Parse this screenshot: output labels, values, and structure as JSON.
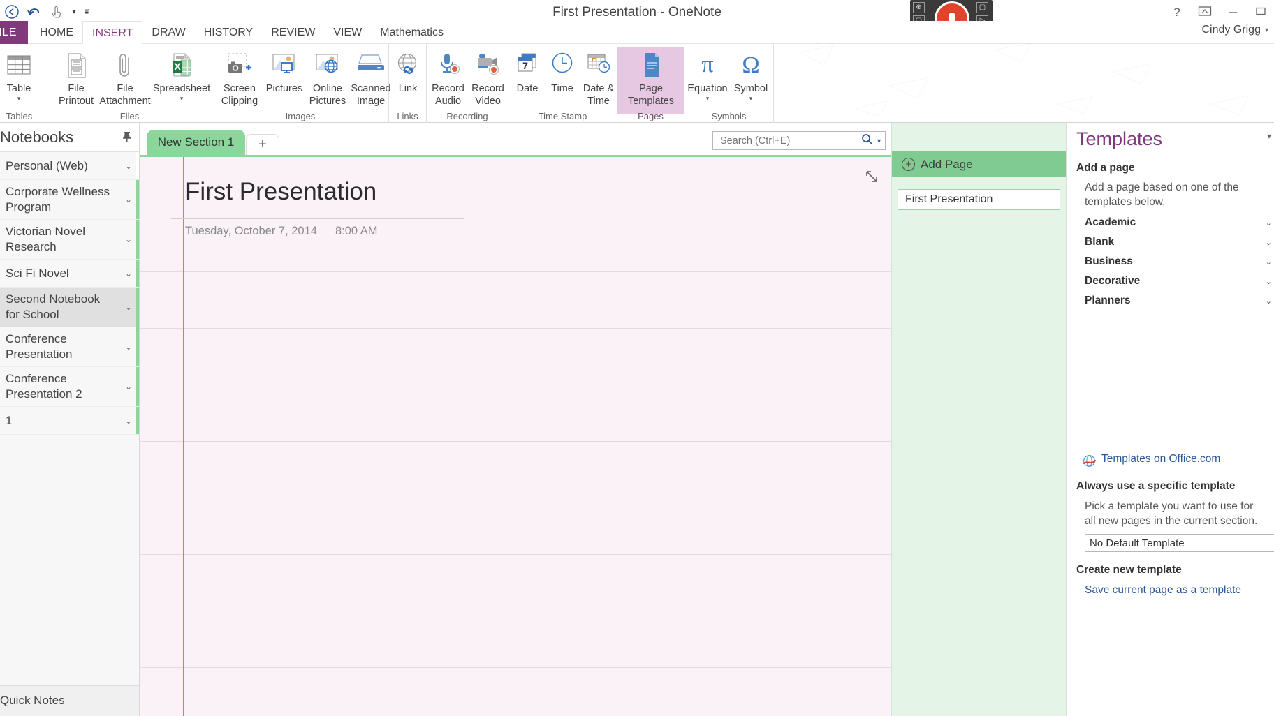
{
  "window": {
    "title": "First Presentation - OneNote",
    "account": "Cindy Grigg",
    "help_icon": "?",
    "ribbon_display_icon": "ribbon-display-options",
    "minimize_icon": "minimize",
    "restore_icon": "restore"
  },
  "quick_access": {
    "back_label": "←",
    "undo_label": "↶",
    "touch_label": "touch-mode",
    "customize_label": "⌄"
  },
  "mic_widget": {
    "label": "record-microphone"
  },
  "tabs": {
    "file": "FILE",
    "items": [
      {
        "label": "HOME",
        "active": false
      },
      {
        "label": "INSERT",
        "active": true
      },
      {
        "label": "DRAW",
        "active": false
      },
      {
        "label": "HISTORY",
        "active": false
      },
      {
        "label": "REVIEW",
        "active": false
      },
      {
        "label": "VIEW",
        "active": false
      },
      {
        "label": "Mathematics",
        "active": false
      }
    ]
  },
  "ribbon": {
    "groups": [
      {
        "name": "Tables",
        "label": "Tables",
        "items": [
          {
            "id": "table",
            "line1": "Table",
            "line2": "",
            "dropdown": true,
            "icon": "table-icon",
            "selected": false
          }
        ]
      },
      {
        "name": "Files",
        "label": "Files",
        "items": [
          {
            "id": "file-printout",
            "line1": "File",
            "line2": "Printout",
            "dropdown": false,
            "icon": "file-printout-icon",
            "selected": false
          },
          {
            "id": "file-attachment",
            "line1": "File",
            "line2": "Attachment",
            "dropdown": false,
            "icon": "paperclip-icon",
            "selected": false
          },
          {
            "id": "spreadsheet",
            "line1": "Spreadsheet",
            "line2": "",
            "dropdown": true,
            "icon": "excel-spreadsheet-icon",
            "selected": false
          }
        ]
      },
      {
        "name": "Images",
        "label": "Images",
        "items": [
          {
            "id": "screen-clipping",
            "line1": "Screen",
            "line2": "Clipping",
            "dropdown": false,
            "icon": "camera-icon",
            "selected": false
          },
          {
            "id": "pictures",
            "line1": "Pictures",
            "line2": "",
            "dropdown": false,
            "icon": "pictures-icon",
            "selected": false
          },
          {
            "id": "online-pictures",
            "line1": "Online",
            "line2": "Pictures",
            "dropdown": false,
            "icon": "online-pictures-icon",
            "selected": false
          },
          {
            "id": "scanned-image",
            "line1": "Scanned",
            "line2": "Image",
            "dropdown": false,
            "icon": "scanner-icon",
            "selected": false
          }
        ]
      },
      {
        "name": "Links",
        "label": "Links",
        "items": [
          {
            "id": "link",
            "line1": "Link",
            "line2": "",
            "dropdown": false,
            "icon": "globe-link-icon",
            "selected": false
          }
        ]
      },
      {
        "name": "Recording",
        "label": "Recording",
        "items": [
          {
            "id": "record-audio",
            "line1": "Record",
            "line2": "Audio",
            "dropdown": false,
            "icon": "microphone-record-icon",
            "selected": false
          },
          {
            "id": "record-video",
            "line1": "Record",
            "line2": "Video",
            "dropdown": false,
            "icon": "video-record-icon",
            "selected": false
          }
        ]
      },
      {
        "name": "Time Stamp",
        "label": "Time Stamp",
        "items": [
          {
            "id": "date",
            "line1": "Date",
            "line2": "",
            "dropdown": false,
            "icon": "calendar-7-icon",
            "selected": false
          },
          {
            "id": "time",
            "line1": "Time",
            "line2": "",
            "dropdown": false,
            "icon": "clock-icon",
            "selected": false
          },
          {
            "id": "date-and-time",
            "line1": "Date &",
            "line2": "Time",
            "dropdown": false,
            "icon": "calendar-clock-icon",
            "selected": false
          }
        ]
      },
      {
        "name": "Pages",
        "label": "Pages",
        "items": [
          {
            "id": "page-templates",
            "line1": "Page",
            "line2": "Templates",
            "dropdown": true,
            "icon": "page-template-icon",
            "selected": true
          }
        ]
      },
      {
        "name": "Symbols",
        "label": "Symbols",
        "items": [
          {
            "id": "equation",
            "line1": "Equation",
            "line2": "",
            "dropdown": true,
            "icon": "pi-icon",
            "selected": false
          },
          {
            "id": "symbol",
            "line1": "Symbol",
            "line2": "",
            "dropdown": true,
            "icon": "omega-icon",
            "selected": false
          }
        ]
      }
    ]
  },
  "navigation": {
    "header": "Notebooks",
    "pin_icon": "pin-icon",
    "notebooks": [
      {
        "label": "Personal (Web)",
        "color": "#ffffff",
        "active": false
      },
      {
        "label": "Corporate Wellness Program",
        "color": "#8ad69b",
        "active": false
      },
      {
        "label": "Victorian Novel Research",
        "color": "#8ad69b",
        "active": false
      },
      {
        "label": "Sci Fi Novel",
        "color": "#8ad69b",
        "active": false
      },
      {
        "label": "Second Notebook for School",
        "color": "#8ad69b",
        "active": true
      },
      {
        "label": "Conference Presentation",
        "color": "#8ad69b",
        "active": false
      },
      {
        "label": "Conference Presentation 2",
        "color": "#8ad69b",
        "active": false
      },
      {
        "label": "1",
        "color": "#8ad69b",
        "active": false
      }
    ],
    "footer": "Quick Notes"
  },
  "section": {
    "tab_label": "New Section 1",
    "add_section_label": "+",
    "tab_color": "#8ad69b"
  },
  "search": {
    "placeholder": "Search (Ctrl+E)",
    "value": "",
    "icon": "search-icon",
    "dropdown_icon": "chevron-down-icon"
  },
  "page": {
    "title": "First Presentation",
    "date": "Tuesday, October 7, 2014",
    "time": "8:00 AM",
    "expand_icon": "expand-page-icon"
  },
  "page_list": {
    "add_page_label": "Add Page",
    "add_icon": "plus-circle-icon",
    "pages": [
      {
        "label": "First Presentation",
        "selected": true
      }
    ]
  },
  "task_pane": {
    "title": "Templates",
    "close_icon": "close-icon",
    "add_a_page_heading": "Add a page",
    "add_a_page_text": "Add a page based on one of the templates below.",
    "categories": [
      {
        "label": "Academic"
      },
      {
        "label": "Blank"
      },
      {
        "label": "Business"
      },
      {
        "label": "Decorative"
      },
      {
        "label": "Planners"
      }
    ],
    "office_link": "Templates on Office.com",
    "office_link_icon": "globe-icon",
    "always_use_heading": "Always use a specific template",
    "always_use_text": "Pick a template you want to use for all new pages in the current section.",
    "default_template_value": "No Default Template",
    "create_new_heading": "Create new template",
    "save_as_template_link": "Save current page as a template"
  },
  "colors": {
    "accent": "#80397b",
    "section_green": "#8ad69b",
    "page_bg": "#faf2f7",
    "rule_red": "#ef6f5f",
    "link_blue": "#2b579a"
  }
}
